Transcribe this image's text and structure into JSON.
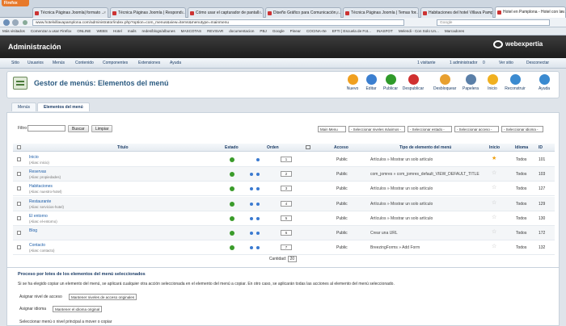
{
  "browser": {
    "app_button": "Firefox",
    "tabs": [
      "Técnica Páginas Joomla| formato ...",
      "Técnica Páginas Joomla | Respond...",
      "Cómo usar el capturador de pantall...",
      "Diseño Gráfico para Comunicación,...",
      "Técnica Páginas Joomla | Temas for...",
      "Habitaciones del hotel Villava Pamp...",
      "Hotel en Pamplona - Hotel con lav..."
    ],
    "url": "www.hotelvillavapamplona.com/administrator/index.php?option=com_menus&view=items&menutype=mainmenu",
    "search_placeholder": "Google",
    "bookmarks": [
      "Más visitados",
      "Comenzar a usar Firefox",
      "ONLINE",
      "WEBS",
      "Hotel",
      "mails",
      "redes/blogs/albunes",
      "MASCOTAS",
      "REVISAR",
      "documentacion",
      "PBJ",
      "Google",
      "Pinear",
      "COCINA-rte",
      "EFTI | Escuela de Fot...",
      "INASFOT",
      "Melendi - Con Solo Un...",
      "Marcadores"
    ]
  },
  "header": {
    "title": "Administración",
    "logo": "webexpertia"
  },
  "menubar": {
    "items": [
      "Sitio",
      "Usuarios",
      "Menús",
      "Contenido",
      "Componentes",
      "Extensiones",
      "Ayuda"
    ],
    "status": [
      "1 visitante",
      "1 administrador",
      "0",
      "Ver sitio",
      "Desconectar"
    ]
  },
  "toolbar": {
    "page_title": "Gestor de menús: Elementos del menú",
    "buttons": [
      {
        "label": "Nuevo",
        "color": "#f0a020"
      },
      {
        "label": "Editar",
        "color": "#3b7fd0"
      },
      {
        "label": "Publicar",
        "color": "#2f9a2a"
      },
      {
        "label": "Despublicar",
        "color": "#d03030"
      },
      {
        "label": "Desbloquear",
        "color": "#e8a030"
      },
      {
        "label": "Papelera",
        "color": "#5a7fa8"
      },
      {
        "label": "Inicio",
        "color": "#f0b020"
      },
      {
        "label": "Reconstruir",
        "color": "#3a8ad0"
      },
      {
        "label": "Ayuda",
        "color": "#3a8ad0"
      }
    ]
  },
  "submenu": {
    "tabs": [
      "Menús",
      "Elementos del menú"
    ]
  },
  "filters": {
    "label": "Filtro",
    "search_button": "Buscar",
    "clear_button": "Limpiar",
    "selects": [
      "Main Menu",
      "- Seleccionar niveles máximos -",
      "- Seleccionar estado -",
      "- Seleccionar acceso -",
      "- Seleccionar idioma -"
    ]
  },
  "table": {
    "headers": {
      "title": "Título",
      "status": "Estado",
      "order": "Orden",
      "access": "Acceso",
      "type": "Tipo de elemento del menú",
      "home": "Inicio",
      "lang": "Idioma",
      "id": "ID"
    },
    "rows": [
      {
        "title": "Inicio",
        "alias": "(Alias: inicio)",
        "order": "1",
        "access": "Public",
        "type": "Artículos » Mostrar un solo artículo",
        "home": true,
        "lang": "Todos",
        "id": "101"
      },
      {
        "title": "Reservas",
        "alias": "(Alias: propiedades)",
        "order": "2",
        "access": "Public",
        "type": "com_jomres » com_jomres_default_VIEW_DEFAULT_TITLE",
        "home": false,
        "lang": "Todos",
        "id": "103"
      },
      {
        "title": "Habitaciones",
        "alias": "(Alias: nuestro-hotel)",
        "order": "3",
        "access": "Public",
        "type": "Artículos » Mostrar un solo artículo",
        "home": false,
        "lang": "Todos",
        "id": "127"
      },
      {
        "title": "Restaurante",
        "alias": "(Alias: servicios-hotel)",
        "order": "4",
        "access": "Public",
        "type": "Artículos » Mostrar un solo artículo",
        "home": false,
        "lang": "Todos",
        "id": "129"
      },
      {
        "title": "El entorno",
        "alias": "(Alias: el-entorno)",
        "order": "5",
        "access": "Public",
        "type": "Artículos » Mostrar un solo artículo",
        "home": false,
        "lang": "Todos",
        "id": "130"
      },
      {
        "title": "Blog",
        "alias": "",
        "order": "6",
        "access": "Public",
        "type": "Crear una URL",
        "home": false,
        "lang": "Todos",
        "id": "172"
      },
      {
        "title": "Contacto",
        "alias": "(Alias: contacto)",
        "order": "7",
        "access": "Public",
        "type": "BreezingForms » Add Form",
        "home": false,
        "lang": "Todos",
        "id": "132"
      }
    ],
    "pager_label": "Cantidad:",
    "pager_value": "20"
  },
  "batch": {
    "title": "Proceso por lotes de los elementos del menú seleccionados",
    "text": "Si se ha elegido copiar un elemento del menú, se aplicará cualquier otra acción seleccionada en el elemento del menú a copiar. En otro caso, se aplicarán todas las acciones al elemento del menú seleccionado.",
    "access_label": "Asignar nivel de acceso",
    "access_value": "Mantener niveles de acceso originales",
    "lang_label": "Asignar idioma",
    "lang_value": "Mantener el idioma original",
    "move_label": "Seleccionar menú o nivel principal a mover o copiar"
  }
}
